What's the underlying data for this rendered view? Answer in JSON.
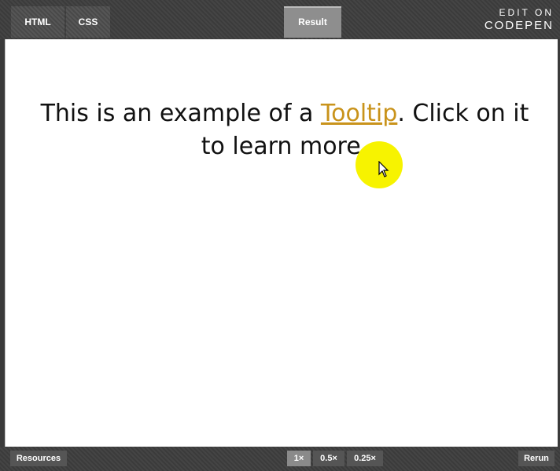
{
  "tabs": {
    "html": "HTML",
    "css": "CSS",
    "result": "Result"
  },
  "logo": {
    "line1": "EDIT ON",
    "line2": "CODEPEN"
  },
  "content": {
    "before": "This is an example of a ",
    "link": "Tooltip",
    "after": ". Click on it to learn more."
  },
  "bottom": {
    "resources": "Resources",
    "zoom": [
      "1×",
      "0.5×",
      "0.25×"
    ],
    "selected_zoom": "1×",
    "rerun": "Rerun"
  },
  "colors": {
    "link": "#c9931b",
    "highlight": "#f7f300",
    "bar": "#3d3d3d"
  }
}
